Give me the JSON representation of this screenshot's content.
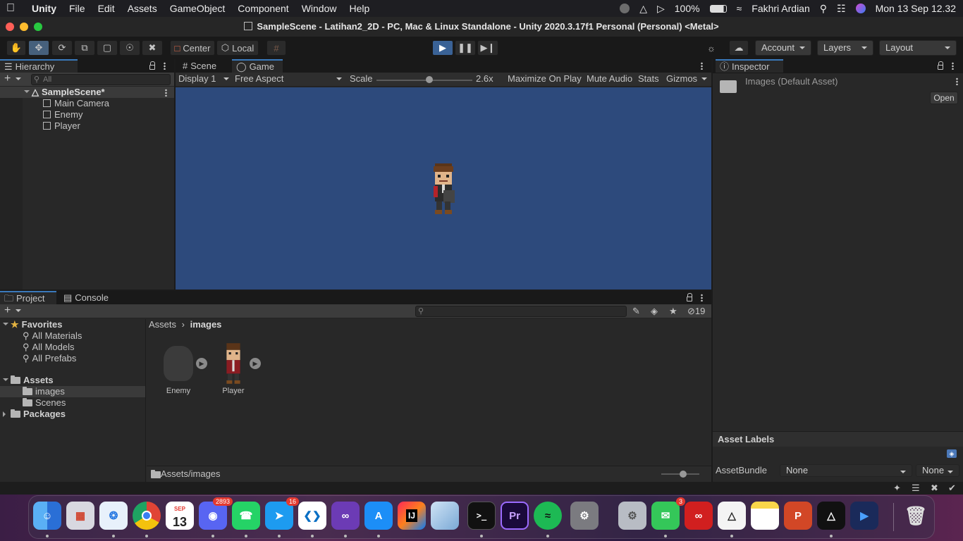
{
  "menubar": {
    "app": "Unity",
    "items": [
      "File",
      "Edit",
      "Assets",
      "GameObject",
      "Component",
      "Window",
      "Help"
    ],
    "battery": "100%",
    "user": "Fakhri Ardian",
    "datetime": "Mon 13 Sep  12.32"
  },
  "window": {
    "title": "SampleScene - Latihan2_2D - PC, Mac & Linux Standalone - Unity 2020.3.17f1 Personal (Personal) <Metal>"
  },
  "toolbar": {
    "pivot": "Center",
    "space": "Local",
    "account": "Account",
    "layers": "Layers",
    "layout": "Layout"
  },
  "hierarchy": {
    "title": "Hierarchy",
    "search_placeholder": "All",
    "scene": "SampleScene*",
    "items": [
      "Main Camera",
      "Enemy",
      "Player"
    ]
  },
  "game": {
    "tabs": [
      "Scene",
      "Game"
    ],
    "display": "Display 1",
    "aspect": "Free Aspect",
    "scale_label": "Scale",
    "scale_value": "2.6x",
    "scale_slider": 0.55,
    "maximize": "Maximize On Play",
    "mute": "Mute Audio",
    "stats": "Stats",
    "gizmos": "Gizmos",
    "bg_color": "#2d4a7c"
  },
  "inspector": {
    "title": "Inspector",
    "asset_name": "Images (Default Asset)",
    "open_button": "Open",
    "labels_title": "Asset Labels",
    "assetbundle_label": "AssetBundle",
    "assetbundle_value": "None",
    "variant_value": "None"
  },
  "project": {
    "tabs": [
      "Project",
      "Console"
    ],
    "hidden_count": "19",
    "favorites": "Favorites",
    "fav_items": [
      "All Materials",
      "All Models",
      "All Prefabs"
    ],
    "assets": "Assets",
    "asset_folders": [
      "images",
      "Scenes"
    ],
    "packages": "Packages",
    "breadcrumb": [
      "Assets",
      "images"
    ],
    "files": [
      "Enemy",
      "Player"
    ],
    "footer_path": "Assets/images"
  },
  "dock": {
    "calendar_month": "SEP",
    "calendar_day": "13",
    "discord_badge": "2893",
    "twitter_badge": "16",
    "messages_badge": "3",
    "intellij": "IJ",
    "premiere": "Pr"
  }
}
